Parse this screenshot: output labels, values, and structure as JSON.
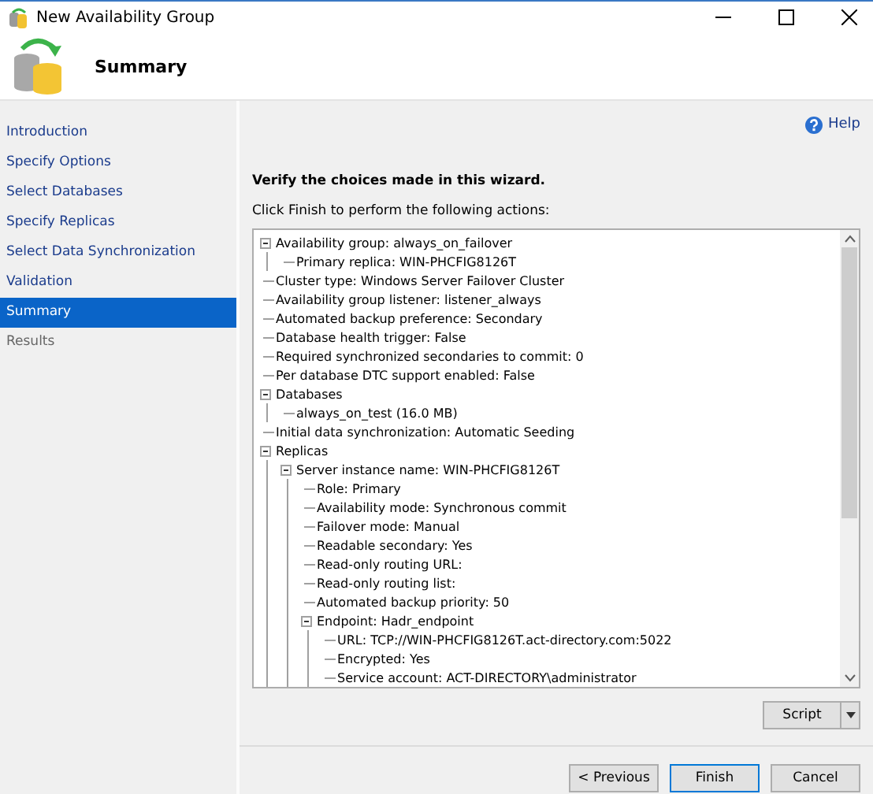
{
  "window": {
    "title": "New Availability Group"
  },
  "header": {
    "title": "Summary"
  },
  "sidebar": {
    "items": [
      {
        "label": "Introduction",
        "selected": false,
        "disabled": false
      },
      {
        "label": "Specify Options",
        "selected": false,
        "disabled": false
      },
      {
        "label": "Select Databases",
        "selected": false,
        "disabled": false
      },
      {
        "label": "Specify Replicas",
        "selected": false,
        "disabled": false
      },
      {
        "label": "Select Data Synchronization",
        "selected": false,
        "disabled": false
      },
      {
        "label": "Validation",
        "selected": false,
        "disabled": false
      },
      {
        "label": "Summary",
        "selected": true,
        "disabled": false
      },
      {
        "label": "Results",
        "selected": false,
        "disabled": true
      }
    ]
  },
  "help": "Help",
  "heading": "Verify the choices made in this wizard.",
  "instruction": "Click Finish to perform the following actions:",
  "tree": [
    {
      "label": "Availability group: always_on_failover",
      "expanded": true,
      "children": [
        {
          "label": "Primary replica: WIN-PHCFIG8126T"
        }
      ]
    },
    {
      "label": "Cluster type: Windows Server Failover Cluster"
    },
    {
      "label": "Availability group listener: listener_always"
    },
    {
      "label": "Automated backup preference: Secondary"
    },
    {
      "label": "Database health trigger: False"
    },
    {
      "label": "Required synchronized secondaries to commit: 0"
    },
    {
      "label": "Per database DTC support enabled: False"
    },
    {
      "label": "Databases",
      "expanded": true,
      "children": [
        {
          "label": "always_on_test (16.0 MB)"
        }
      ]
    },
    {
      "label": "Initial data synchronization: Automatic Seeding"
    },
    {
      "label": "Replicas",
      "expanded": true,
      "children": [
        {
          "label": "Server instance name: WIN-PHCFIG8126T",
          "expanded": true,
          "children": [
            {
              "label": "Role: Primary"
            },
            {
              "label": "Availability mode: Synchronous commit"
            },
            {
              "label": "Failover mode: Manual"
            },
            {
              "label": "Readable secondary: Yes"
            },
            {
              "label": "Read-only routing URL:"
            },
            {
              "label": "Read-only routing list:"
            },
            {
              "label": "Automated backup priority: 50"
            },
            {
              "label": "Endpoint: Hadr_endpoint",
              "expanded": true,
              "children": [
                {
                  "label": "URL: TCP://WIN-PHCFIG8126T.act-directory.com:5022"
                },
                {
                  "label": "Encrypted: Yes"
                },
                {
                  "label": "Service account: ACT-DIRECTORY\\administrator"
                }
              ]
            }
          ]
        }
      ]
    }
  ],
  "script_button": "Script",
  "buttons": [
    {
      "label": "< Previous",
      "selected": false
    },
    {
      "label": "Finish",
      "selected": true
    },
    {
      "label": "Cancel",
      "selected": false
    }
  ]
}
